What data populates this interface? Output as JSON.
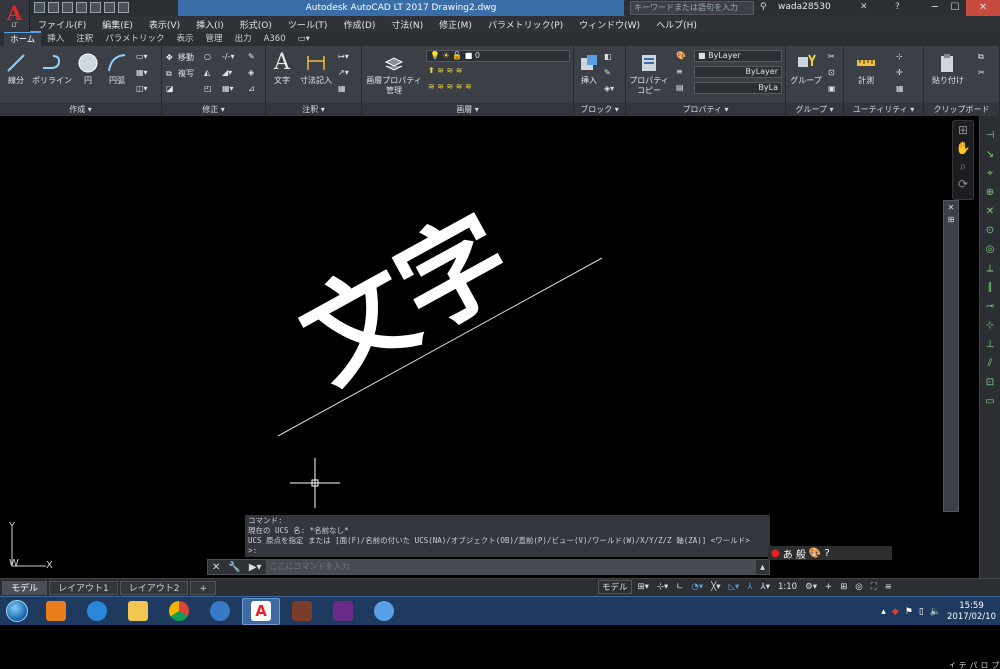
{
  "app": {
    "logo": "A",
    "edition": "LT",
    "title": "Autodesk AutoCAD LT 2017    Drawing2.dwg"
  },
  "search": {
    "placeholder": "キーワードまたは語句を入力"
  },
  "user": {
    "name": "wada28530"
  },
  "menu": [
    "ファイル(F)",
    "編集(E)",
    "表示(V)",
    "挿入(I)",
    "形式(O)",
    "ツール(T)",
    "作成(D)",
    "寸法(N)",
    "修正(M)",
    "パラメトリック(P)",
    "ウィンドウ(W)",
    "ヘルプ(H)"
  ],
  "ribbon_tabs": [
    "ホーム",
    "挿入",
    "注釈",
    "パラメトリック",
    "表示",
    "管理",
    "出力",
    "A360"
  ],
  "ribbon": {
    "draw": {
      "label": "作成 ▾",
      "line": "線分",
      "polyline": "ポリライン",
      "circle": "円",
      "arc": "円弧"
    },
    "modify": {
      "label": "修正 ▾",
      "move": "移動",
      "copy": "複写"
    },
    "annotation": {
      "label": "注釈 ▾",
      "text": "文字",
      "dimension": "寸法記入"
    },
    "layers": {
      "label": "画層 ▾",
      "layer_props": "画層プロパティ",
      "layer_props2": "管理",
      "current_layer": "0"
    },
    "block": {
      "label": "ブロック ▾",
      "insert": "挿入"
    },
    "properties": {
      "label": "プロパティ ▾",
      "match": "プロパティ",
      "match2": "コピー",
      "color": "ByLayer",
      "linetype": "ByLayer",
      "lineweight": "ByLa"
    },
    "groups": {
      "label": "グループ ▾",
      "group": "グループ"
    },
    "utilities": {
      "label": "ユーティリティ ▾",
      "measure": "計測"
    },
    "clipboard": {
      "label": "クリップボード",
      "paste": "貼り付け"
    }
  },
  "drawing": {
    "text": "文字"
  },
  "ucs": {
    "y": "Y",
    "w": "W",
    "x": "X"
  },
  "command": {
    "history": [
      "コマンド:",
      "現在の UCS 名:  *名前なし*",
      "UCS 原点を指定 または [面(F)/名前の付いた UCS(NA)/オブジェクト(OB)/直前(P)/ビュー(V)/ワールド(W)/X/Y/Z/Z 軸(ZA)] <ワールド>",
      ">:"
    ],
    "placeholder": "ここにコマンドを入力"
  },
  "ime": {
    "mode": "あ 般"
  },
  "layout_tabs": [
    "モデル",
    "レイアウト1",
    "レイアウト2",
    "+"
  ],
  "statusbar": {
    "model": "モデル",
    "scale": "1:10"
  },
  "properties_palette": {
    "label": "プロパティ"
  },
  "taskbar": {
    "time": "15:59",
    "date": "2017/02/10"
  },
  "colors": {
    "accent": "#3a6ea8",
    "canvas": "#000000",
    "ribbon": "#3b4047"
  }
}
